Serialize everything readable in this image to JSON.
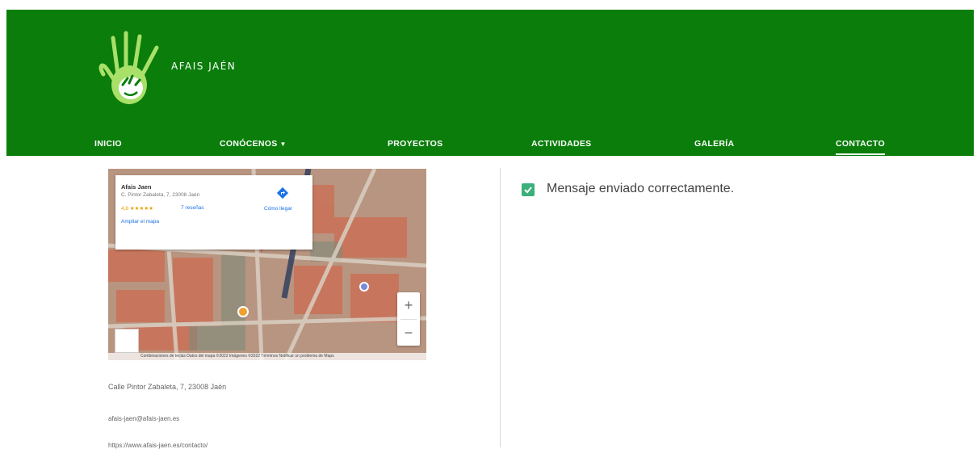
{
  "brand": {
    "name": "AFAIS JAÉN",
    "logo_icon": "hand-logo-icon"
  },
  "colors": {
    "header": "#0a7d0a",
    "accent_check": "#3bb07a",
    "map_pin": "#e53935"
  },
  "nav": {
    "inicio": "INICIO",
    "conocenos": "CONÓCENOS",
    "proyectos": "PROYECTOS",
    "actividades": "ACTIVIDADES",
    "galeria": "GALERÍA",
    "contacto": "CONTACTO",
    "active": "CONTACTO"
  },
  "map": {
    "place_name": "Afais Jaen",
    "place_address": "C. Pintor Zabaleta, 7, 23008 Jaén",
    "rating": "4,8 ★★★★★",
    "reviews": "7 reseñas",
    "enlarge": "Ampliar el mapa",
    "directions": "Cómo llegar",
    "zoom_in": "+",
    "zoom_out": "−",
    "attribution": "Combinaciones de teclas   Datos del mapa ©2022 Imágenes ©2022   Términos   Notificar un problema de Maps"
  },
  "contact": {
    "address": "Calle Pintor Zabaleta, 7, 23008 Jaén",
    "email": "afais-jaen@afais-jaen.es",
    "website": "https://www.afais-jaen.es/contacto/"
  },
  "form": {
    "success_message": "Mensaje enviado correctamente."
  }
}
